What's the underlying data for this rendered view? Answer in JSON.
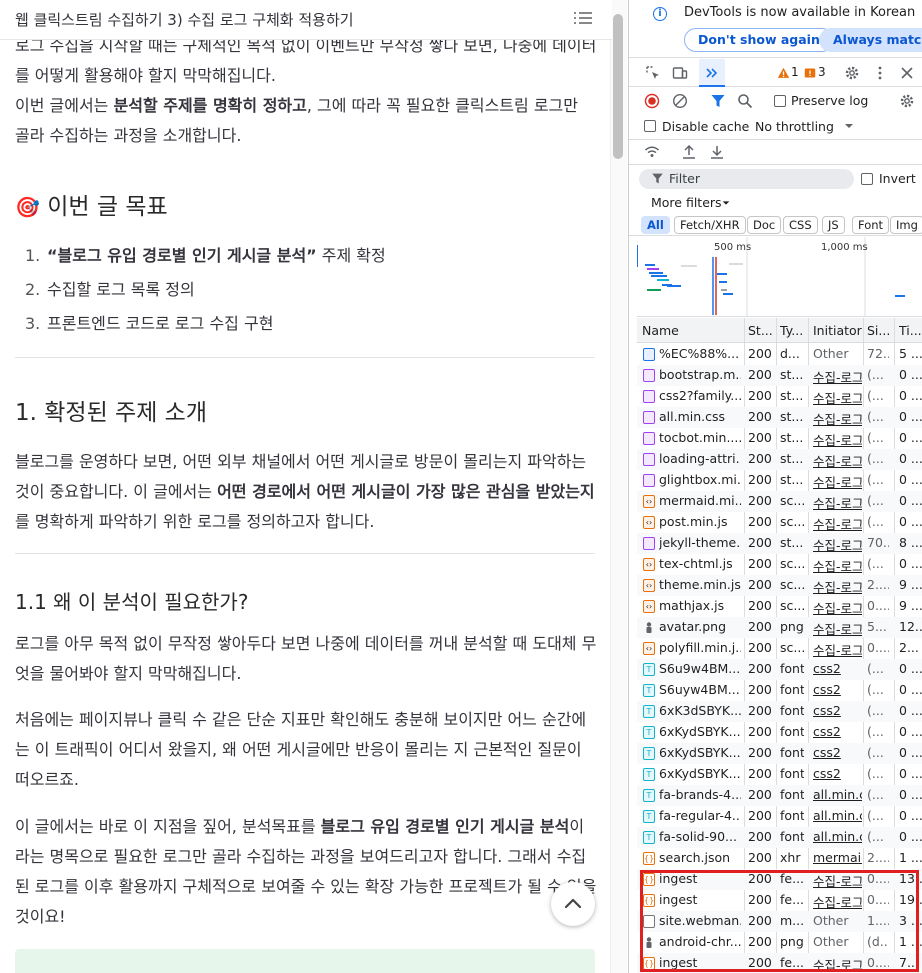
{
  "blog": {
    "top_title": "웹 클릭스트림 수집하기 3) 수집 로그 구체화 적용하기",
    "intro": {
      "p1": "로그 수집을 시작할 때는 구체적인 목적 없이 이벤트만 무작정 쌓다 보면, 나중에 데이터를 어떻게 활용해야 할지 막막해집니다.",
      "p2_pre": "이번 글에서는 ",
      "p2_bold": "분석할 주제를 명확히 정하고",
      "p2_post": ", 그에 따라 꼭 필요한 클릭스트림 로그만 골라 수집하는 과정을 소개합니다."
    },
    "goals": {
      "heading_emoji": "🎯",
      "heading": "이번 글 목표",
      "items": [
        {
          "num": "1.",
          "bold": "“블로그 유입 경로별 인기 게시글 분석”",
          "text": " 주제 확정"
        },
        {
          "num": "2.",
          "bold": "",
          "text": "수집할 로그 목록 정의"
        },
        {
          "num": "3.",
          "bold": "",
          "text": "프론트엔드 코드로 로그 수집 구현"
        }
      ]
    },
    "section1": {
      "heading": "1. 확정된 주제 소개",
      "p_pre": "블로그를 운영하다 보면, 어떤 외부 채널에서 어떤 게시글로 방문이 몰리는지 파악하는 것이 중요합니다. 이 글에서는 ",
      "p_bold": "어떤 경로에서 어떤 게시글이 가장 많은 관심을 받았는지",
      "p_post": "를 명확하게 파악하기 위한 로그를 정의하고자 합니다."
    },
    "section11": {
      "heading": "1.1 왜 이 분석이 필요한가?",
      "p1": "로그를 아무 목적 없이 무작정 쌓아두다 보면 나중에 데이터를 꺼내 분석할 때 도대체 무엇을 물어봐야 할지 막막해집니다.",
      "p2": "처음에는 페이지뷰나 클릭 수 같은 단순 지표만 확인해도 충분해 보이지만 어느 순간에는 이 트래픽이 어디서 왔을지, 왜 어떤 게시글에만 반응이 몰리는 지 근본적인 질문이 떠오르죠.",
      "p3_pre": "이 글에서는 바로 이 지점을 짚어, 분석목표를 ",
      "p3_bold": "블로그 유입 경로별 인기 게시글 분석",
      "p3_post": "이라는 명목으로 필요한 로그만 골라 수집하는 과정을 보여드리고자 합니다. 그래서 수집된 로그를 이후 활용까지 구체적으로 보여줄 수 있는 확장 가능한 프로젝트가 될 수 있을 것이요!"
    }
  },
  "devtools": {
    "info_text": "DevTools is now available in Korean",
    "btn_dont_show": "Don't show again",
    "btn_always_match": "Always match C",
    "warning_count": "1",
    "error_count": "3",
    "preserve_log": "Preserve log",
    "disable_cache": "Disable cache",
    "throttling": "No throttling",
    "filter_placeholder": "Filter",
    "invert": "Invert",
    "more_filters": "More filters",
    "type_chips": [
      "All",
      "Fetch/XHR",
      "Doc",
      "CSS",
      "JS",
      "Font",
      "Img"
    ],
    "overview_ticks": [
      "500 ms",
      "1,000 ms"
    ],
    "columns": [
      "Name",
      "St...",
      "Ty...",
      "Initiator",
      "Si...",
      "Ti..."
    ],
    "rows": [
      {
        "icon": "doc",
        "name": "%EC%88%...",
        "status": "200",
        "type": "d...",
        "initiator": "Other",
        "size": "72...",
        "time": "5 ..."
      },
      {
        "icon": "css",
        "name": "bootstrap.m...",
        "status": "200",
        "type": "st...",
        "initiator": "수집-로그-",
        "size": "(...",
        "time": "0 ..."
      },
      {
        "icon": "css",
        "name": "css2?family...",
        "status": "200",
        "type": "st...",
        "initiator": "수집-로그-",
        "size": "(...",
        "time": "0 ..."
      },
      {
        "icon": "css",
        "name": "all.min.css",
        "status": "200",
        "type": "st...",
        "initiator": "수집-로그-",
        "size": "(...",
        "time": "0 ..."
      },
      {
        "icon": "css",
        "name": "tocbot.min....",
        "status": "200",
        "type": "st...",
        "initiator": "수집-로그-",
        "size": "(...",
        "time": "0 ..."
      },
      {
        "icon": "css",
        "name": "loading-attri...",
        "status": "200",
        "type": "st...",
        "initiator": "수집-로그-",
        "size": "(...",
        "time": "0 ..."
      },
      {
        "icon": "css",
        "name": "glightbox.mi...",
        "status": "200",
        "type": "st...",
        "initiator": "수집-로그-",
        "size": "(...",
        "time": "0 ..."
      },
      {
        "icon": "js",
        "name": "mermaid.mi...",
        "status": "200",
        "type": "sc...",
        "initiator": "수집-로그-",
        "size": "(...",
        "time": "0 ..."
      },
      {
        "icon": "js",
        "name": "post.min.js",
        "status": "200",
        "type": "sc...",
        "initiator": "수집-로그-",
        "size": "(...",
        "time": "0 ..."
      },
      {
        "icon": "css",
        "name": "jekyll-theme...",
        "status": "200",
        "type": "st...",
        "initiator": "수집-로그-",
        "size": "70...",
        "time": "8 ..."
      },
      {
        "icon": "js",
        "name": "tex-chtml.js",
        "status": "200",
        "type": "sc...",
        "initiator": "수집-로그-",
        "size": "(...",
        "time": "0 ..."
      },
      {
        "icon": "js",
        "name": "theme.min.js",
        "status": "200",
        "type": "sc...",
        "initiator": "수집-로그-",
        "size": "2....",
        "time": "9 ..."
      },
      {
        "icon": "js",
        "name": "mathjax.js",
        "status": "200",
        "type": "sc...",
        "initiator": "수집-로그-",
        "size": "0....",
        "time": "9 ..."
      },
      {
        "icon": "img",
        "name": "avatar.png",
        "status": "200",
        "type": "png",
        "initiator": "수집-로그-",
        "size": "5...",
        "time": "12..."
      },
      {
        "icon": "js",
        "name": "polyfill.min.j...",
        "status": "200",
        "type": "sc...",
        "initiator": "수집-로그-",
        "size": "0....",
        "time": "2..."
      },
      {
        "icon": "font",
        "name": "S6u9w4BM...",
        "status": "200",
        "type": "font",
        "initiator": "css2",
        "size": "(...",
        "time": "0 ..."
      },
      {
        "icon": "font",
        "name": "S6uyw4BM...",
        "status": "200",
        "type": "font",
        "initiator": "css2",
        "size": "(...",
        "time": "0 ..."
      },
      {
        "icon": "font",
        "name": "6xK3dSBYK...",
        "status": "200",
        "type": "font",
        "initiator": "css2",
        "size": "(...",
        "time": "0 ..."
      },
      {
        "icon": "font",
        "name": "6xKydSBYK...",
        "status": "200",
        "type": "font",
        "initiator": "css2",
        "size": "(...",
        "time": "0 ..."
      },
      {
        "icon": "font",
        "name": "6xKydSBYK...",
        "status": "200",
        "type": "font",
        "initiator": "css2",
        "size": "(...",
        "time": "0 ..."
      },
      {
        "icon": "font",
        "name": "6xKydSBYK...",
        "status": "200",
        "type": "font",
        "initiator": "css2",
        "size": "(...",
        "time": "0 ..."
      },
      {
        "icon": "font",
        "name": "fa-brands-4...",
        "status": "200",
        "type": "font",
        "initiator": "all.min.cs",
        "size": "(...",
        "time": "0 ..."
      },
      {
        "icon": "font",
        "name": "fa-regular-4...",
        "status": "200",
        "type": "font",
        "initiator": "all.min.cs",
        "size": "(...",
        "time": "0 ..."
      },
      {
        "icon": "font",
        "name": "fa-solid-90...",
        "status": "200",
        "type": "font",
        "initiator": "all.min.cs",
        "size": "(...",
        "time": "0 ..."
      },
      {
        "icon": "xhr",
        "name": "search.json",
        "status": "200",
        "type": "xhr",
        "initiator": "mermaid",
        "size": "2....",
        "time": "1 ..."
      },
      {
        "icon": "xhr",
        "name": "ingest",
        "status": "200",
        "type": "fe...",
        "initiator": "수집-로그-",
        "size": "0....",
        "time": "13..."
      },
      {
        "icon": "xhr",
        "name": "ingest",
        "status": "200",
        "type": "fe...",
        "initiator": "수집-로그-",
        "size": "0....",
        "time": "19..."
      },
      {
        "icon": "mani",
        "name": "site.webman...",
        "status": "200",
        "type": "m...",
        "initiator": "Other",
        "size": "1....",
        "time": "3 ..."
      },
      {
        "icon": "img",
        "name": "android-chr...",
        "status": "200",
        "type": "png",
        "initiator": "Other",
        "size": "(d...",
        "time": "1 ..."
      },
      {
        "icon": "xhr",
        "name": "ingest",
        "status": "200",
        "type": "fe...",
        "initiator": "수집-로그-",
        "size": "0....",
        "time": "7..."
      }
    ]
  }
}
